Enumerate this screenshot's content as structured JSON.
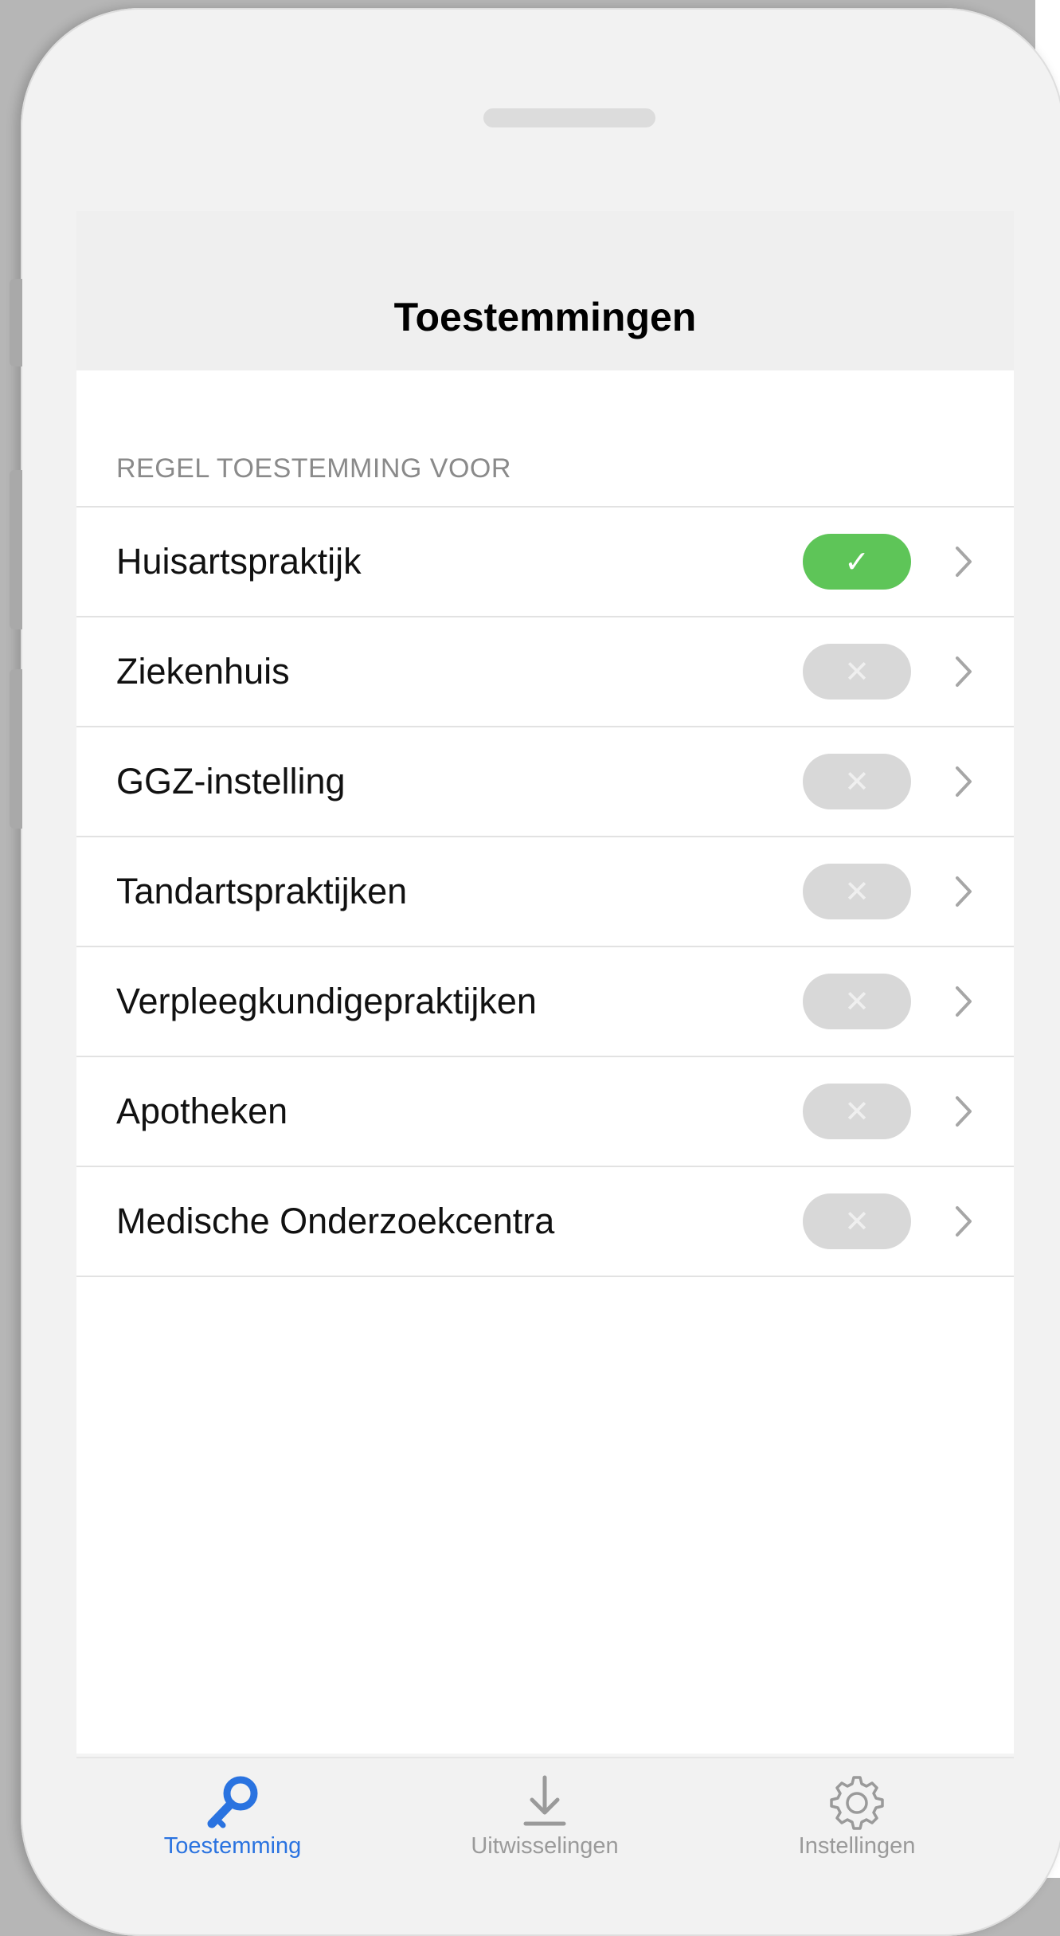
{
  "nav": {
    "title": "Toestemmingen"
  },
  "section": {
    "header": "REGEL TOESTEMMING VOOR"
  },
  "rows": [
    {
      "label": "Huisartspraktijk",
      "enabled": true
    },
    {
      "label": "Ziekenhuis",
      "enabled": false
    },
    {
      "label": "GGZ-instelling",
      "enabled": false
    },
    {
      "label": "Tandartspraktijken",
      "enabled": false
    },
    {
      "label": "Verpleegkundigepraktijken",
      "enabled": false
    },
    {
      "label": "Apotheken",
      "enabled": false
    },
    {
      "label": "Medische Onderzoekcentra",
      "enabled": false
    }
  ],
  "toggle_symbols": {
    "on": "✓",
    "off": "✕"
  },
  "tabs": [
    {
      "label": "Toestemming",
      "icon": "key-icon",
      "active": true
    },
    {
      "label": "Uitwisselingen",
      "icon": "download-icon",
      "active": false
    },
    {
      "label": "Instellingen",
      "icon": "gear-icon",
      "active": false
    }
  ],
  "colors": {
    "toggle_on": "#5ec558",
    "toggle_off": "#d8d8d8",
    "tab_active": "#2a73e0",
    "tab_inactive": "#9a9a9a"
  }
}
